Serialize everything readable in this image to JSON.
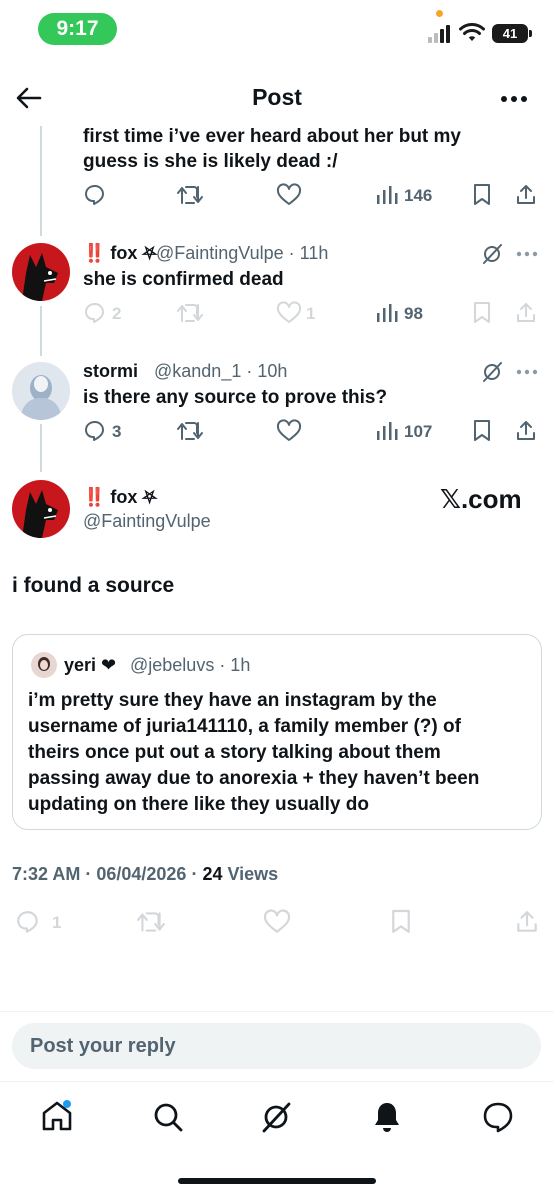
{
  "status_bar": {
    "time": "9:17",
    "battery": "41"
  },
  "header": {
    "title": "Post"
  },
  "tweet_top": {
    "text_line1": "first time i’ve ever heard about her but my",
    "text_line2": "guess is she is likely dead :/",
    "views": "146"
  },
  "tweet_fox1": {
    "name": "‼️ fox ⛧",
    "handle_time": "@FaintingVulpe · 11h",
    "text": "she is confirmed dead",
    "replies": "2",
    "likes": "1",
    "views": "98"
  },
  "tweet_stormi": {
    "name": "stormi",
    "handle_time": "@kandn_1 · 10h",
    "text": "is there any source to prove this?",
    "replies": "3",
    "views": "107"
  },
  "main_tweet": {
    "name": "‼️ fox ⛧",
    "handle": "@FaintingVulpe",
    "watermark": "𝕏.com",
    "text": "i found a source",
    "quote": {
      "name": "yeri ❤",
      "handle_time": "@jebeluvs · 1h",
      "lines": [
        "i’m pretty sure they have an instagram by the",
        "username of juria141110, a family member (?) of",
        "theirs once put out a story talking about them",
        "passing away due to anorexia + they haven’t been",
        "updating on there like they usually do"
      ]
    },
    "timestamp": "7:32 AM · 06/04/2026 · ",
    "views_count": "24",
    "views_label": " Views",
    "replies": "1"
  },
  "reply": {
    "placeholder": "Post your reply"
  },
  "colors": {
    "accent": "#1d9bf0",
    "text": "#0f1419",
    "secondary": "#536471",
    "status_green": "#34c759"
  },
  "icons": [
    "back-arrow-icon",
    "more-icon",
    "reply-icon",
    "repost-icon",
    "like-icon",
    "views-icon",
    "bookmark-icon",
    "share-icon",
    "grok-icon",
    "home-icon",
    "search-icon",
    "notifications-icon",
    "messages-icon"
  ]
}
